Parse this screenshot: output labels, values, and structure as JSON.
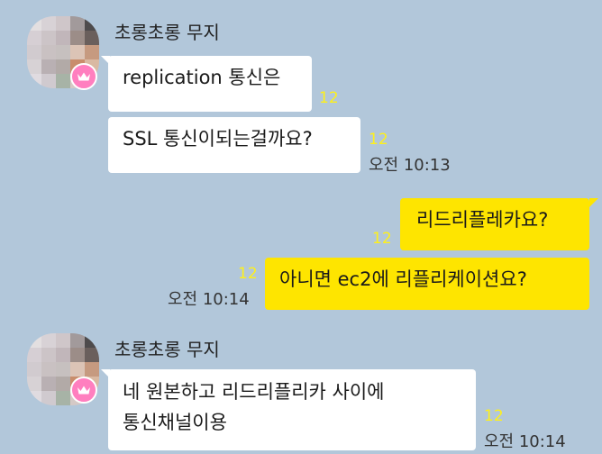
{
  "messages": [
    {
      "sender": "초롱초롱 무지",
      "lines": [
        "replication 통신은"
      ],
      "unread": "12"
    },
    {
      "lines": [
        "SSL 통신이되는걸까요?"
      ],
      "unread": "12",
      "time": "오전 10:13"
    },
    {
      "lines": [
        "리드리플레카요?"
      ],
      "unread": "12"
    },
    {
      "lines": [
        "아니면 ec2에 리플리케이션요?"
      ],
      "unread": "12",
      "time": "오전 10:14"
    },
    {
      "sender": "초롱초롱 무지",
      "lines": [
        "네 원본하고 리드리플리카 사이에",
        "통신채널이용"
      ],
      "unread": "12",
      "time": "오전 10:14"
    }
  ],
  "colors": {
    "background": "#b2c7da",
    "incoming_bubble": "#ffffff",
    "outgoing_bubble": "#fee500",
    "unread_count": "#fef01b",
    "badge": "#ff7fbf"
  },
  "icons": {
    "profile_badge": "crown-icon"
  }
}
